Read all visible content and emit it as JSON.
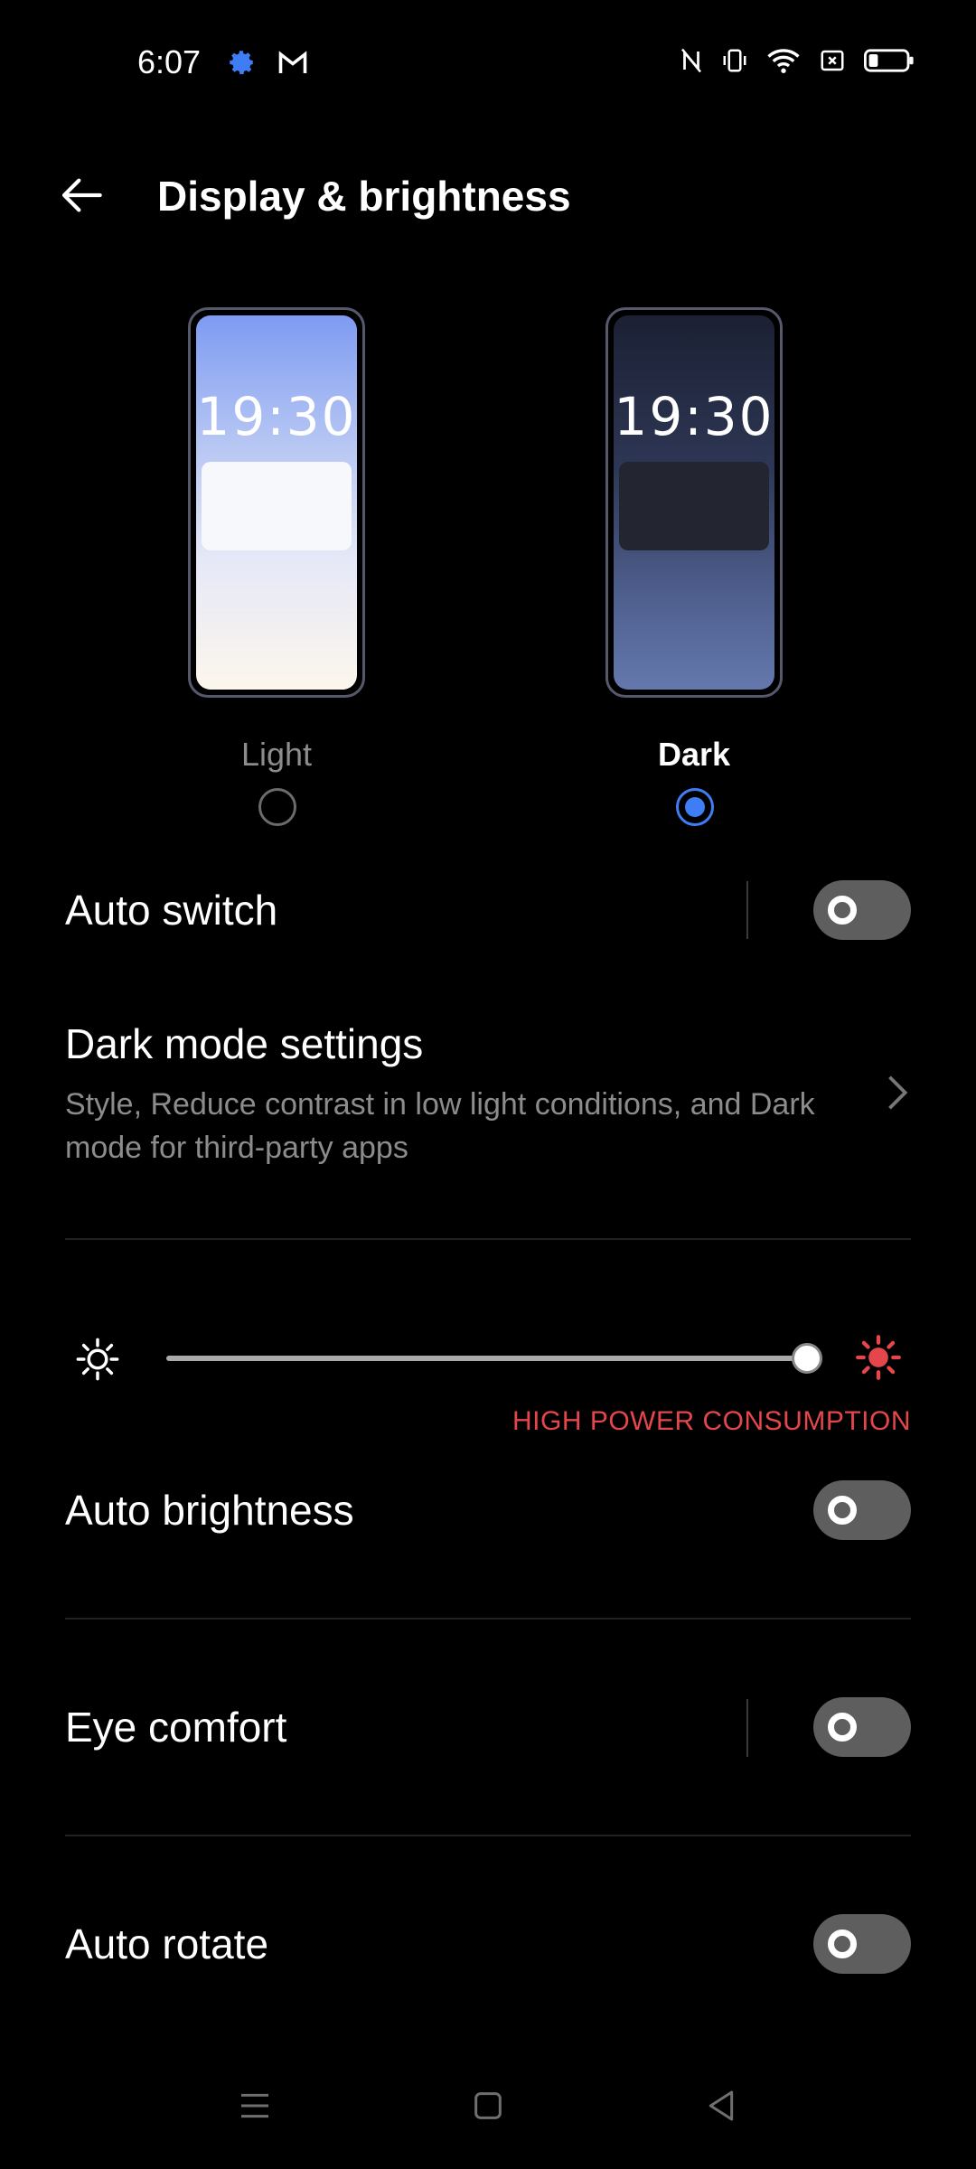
{
  "status_bar": {
    "time": "6:07",
    "left_icons": [
      "gear-icon",
      "gmail-icon"
    ],
    "right_icons": [
      "nfc-icon",
      "vibrate-icon",
      "wifi-icon",
      "no-sim-icon",
      "battery-icon"
    ]
  },
  "header": {
    "title": "Display & brightness",
    "back_icon": "arrow-left-icon"
  },
  "theme": {
    "options": [
      {
        "label": "Light",
        "preview_time": "19:30",
        "selected": false
      },
      {
        "label": "Dark",
        "preview_time": "19:30",
        "selected": true
      }
    ]
  },
  "rows": {
    "auto_switch": {
      "label": "Auto switch",
      "enabled": false
    },
    "dark_mode_settings": {
      "label": "Dark mode settings",
      "subtitle": "Style, Reduce contrast in low light conditions, and Dark mode for third-party apps"
    },
    "brightness": {
      "level": 0.97,
      "warning": "HIGH POWER CONSUMPTION"
    },
    "auto_brightness": {
      "label": "Auto brightness",
      "enabled": false
    },
    "eye_comfort": {
      "label": "Eye comfort",
      "enabled": false
    },
    "auto_rotate": {
      "label": "Auto rotate",
      "enabled": false
    }
  },
  "nav_bar": [
    "menu-icon",
    "home-icon",
    "back-icon"
  ],
  "colors": {
    "accent": "#3f7df5",
    "warning": "#e5464b",
    "background": "#000000"
  }
}
